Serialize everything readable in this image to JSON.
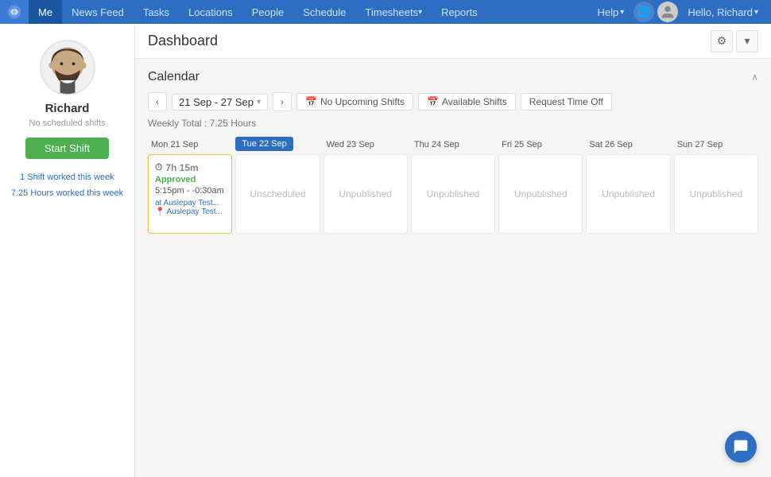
{
  "nav": {
    "logo_label": "Deputy",
    "items": [
      {
        "label": "Me",
        "active": true
      },
      {
        "label": "News Feed",
        "active": false
      },
      {
        "label": "Tasks",
        "active": false
      },
      {
        "label": "Locations",
        "active": false
      },
      {
        "label": "People",
        "active": false
      },
      {
        "label": "Schedule",
        "active": false
      },
      {
        "label": "Timesheets",
        "active": false,
        "has_arrow": true
      },
      {
        "label": "Reports",
        "active": false
      }
    ],
    "help_label": "Help",
    "hello_label": "Hello, Richard"
  },
  "sidebar": {
    "name": "Richard",
    "subtitle": "No scheduled shifts",
    "start_shift_label": "Start Shift",
    "stats": [
      {
        "label": "1 Shift worked this week"
      },
      {
        "label": "7.25 Hours worked this week"
      }
    ]
  },
  "dashboard": {
    "title": "Dashboard",
    "calendar_title": "Calendar",
    "date_range": "21 Sep - 27 Sep",
    "weekly_total": "Weekly Total : 7.25 Hours",
    "no_upcoming_shifts": "No Upcoming Shifts",
    "available_shifts": "Available Shifts",
    "request_time_off": "Request Time Off",
    "days": [
      {
        "label": "Mon 21 Sep",
        "today": false,
        "content": "shift",
        "shift": {
          "duration": "7h 15m",
          "status": "Approved",
          "hours": "5:15pm - -0:30am",
          "location1": "at Auslepay Test...",
          "location2": "Auslepay Test..."
        }
      },
      {
        "label": "Tue 22 Sep",
        "today": true,
        "content": "unscheduled",
        "cell_text": "Unscheduled"
      },
      {
        "label": "Wed 23 Sep",
        "today": false,
        "content": "unpublished",
        "cell_text": "Unpublished"
      },
      {
        "label": "Thu 24 Sep",
        "today": false,
        "content": "unpublished",
        "cell_text": "Unpublished"
      },
      {
        "label": "Fri 25 Sep",
        "today": false,
        "content": "unpublished",
        "cell_text": "Unpublished"
      },
      {
        "label": "Sat 26 Sep",
        "today": false,
        "content": "unpublished",
        "cell_text": "Unpublished"
      },
      {
        "label": "Sun 27 Sep",
        "today": false,
        "content": "unpublished",
        "cell_text": "Unpublished"
      }
    ]
  },
  "icons": {
    "refresh": "⚙",
    "chevron_down": "▾",
    "chevron_up": "∧",
    "chevron_left": "‹",
    "chevron_right": "›",
    "calendar": "📅",
    "clock": "⏱",
    "pin": "📍",
    "chat": "💬"
  }
}
